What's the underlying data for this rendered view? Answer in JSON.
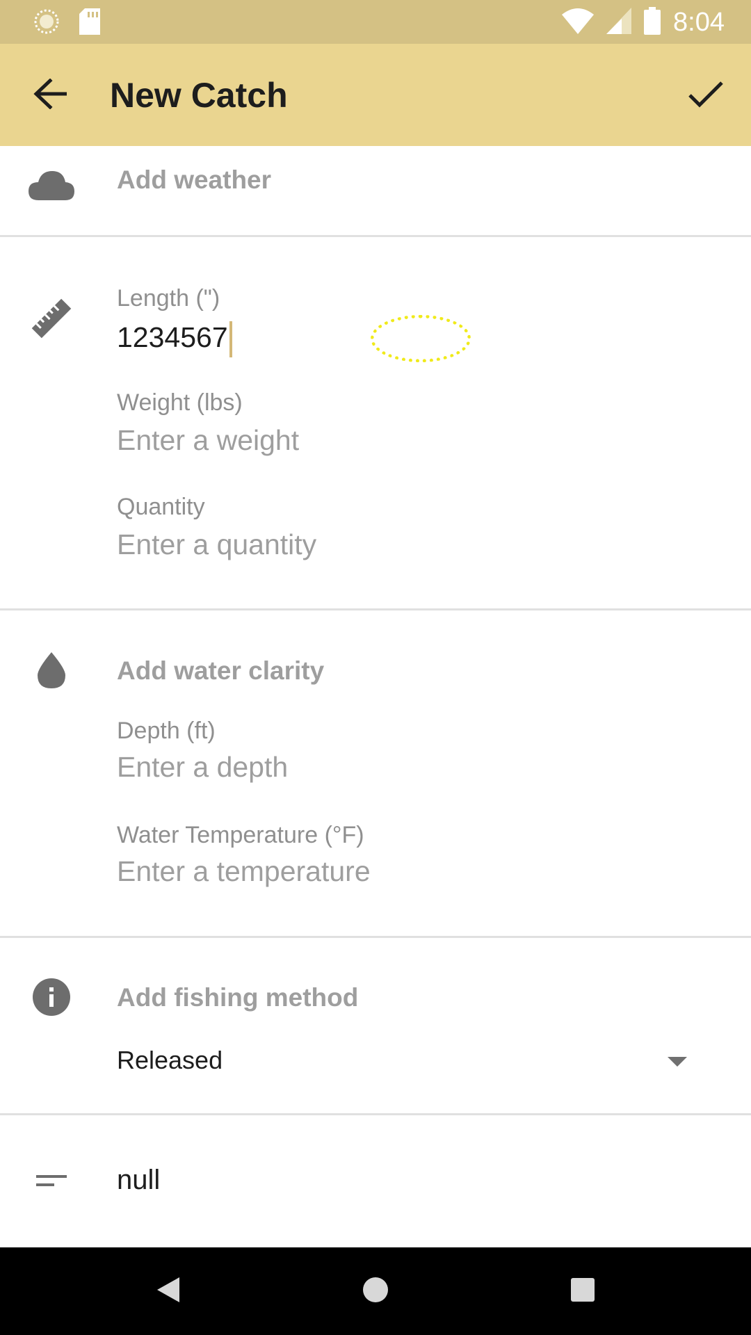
{
  "status_bar": {
    "time": "8:04",
    "icons": [
      "circle-icon",
      "sd-card-icon",
      "wifi-icon",
      "signal-icon",
      "battery-icon"
    ]
  },
  "app_bar": {
    "title": "New Catch",
    "back_icon": "back-arrow-icon",
    "save_icon": "check-icon"
  },
  "form": {
    "weather_label": "Add weather",
    "length": {
      "label": "Length (\")",
      "value": "1234567"
    },
    "weight": {
      "label": "Weight (lbs)",
      "placeholder": "Enter a weight"
    },
    "quantity": {
      "label": "Quantity",
      "placeholder": "Enter a quantity"
    },
    "water_clarity_label": "Add water clarity",
    "depth": {
      "label": "Depth (ft)",
      "placeholder": "Enter a depth"
    },
    "water_temperature": {
      "label": "Water Temperature (°F)",
      "placeholder": "Enter a temperature"
    },
    "fishing_method_label": "Add fishing method",
    "catch_status": {
      "selected": "Released"
    },
    "notes": {
      "value": "null"
    }
  },
  "nav_bar": {
    "icons": [
      "nav-back-icon",
      "nav-home-icon",
      "nav-recents-icon"
    ]
  },
  "colors": {
    "status_bar": "#d4c184",
    "app_bar": "#ead590",
    "accent_caret": "#d4b877",
    "icon_gray": "#707070"
  }
}
